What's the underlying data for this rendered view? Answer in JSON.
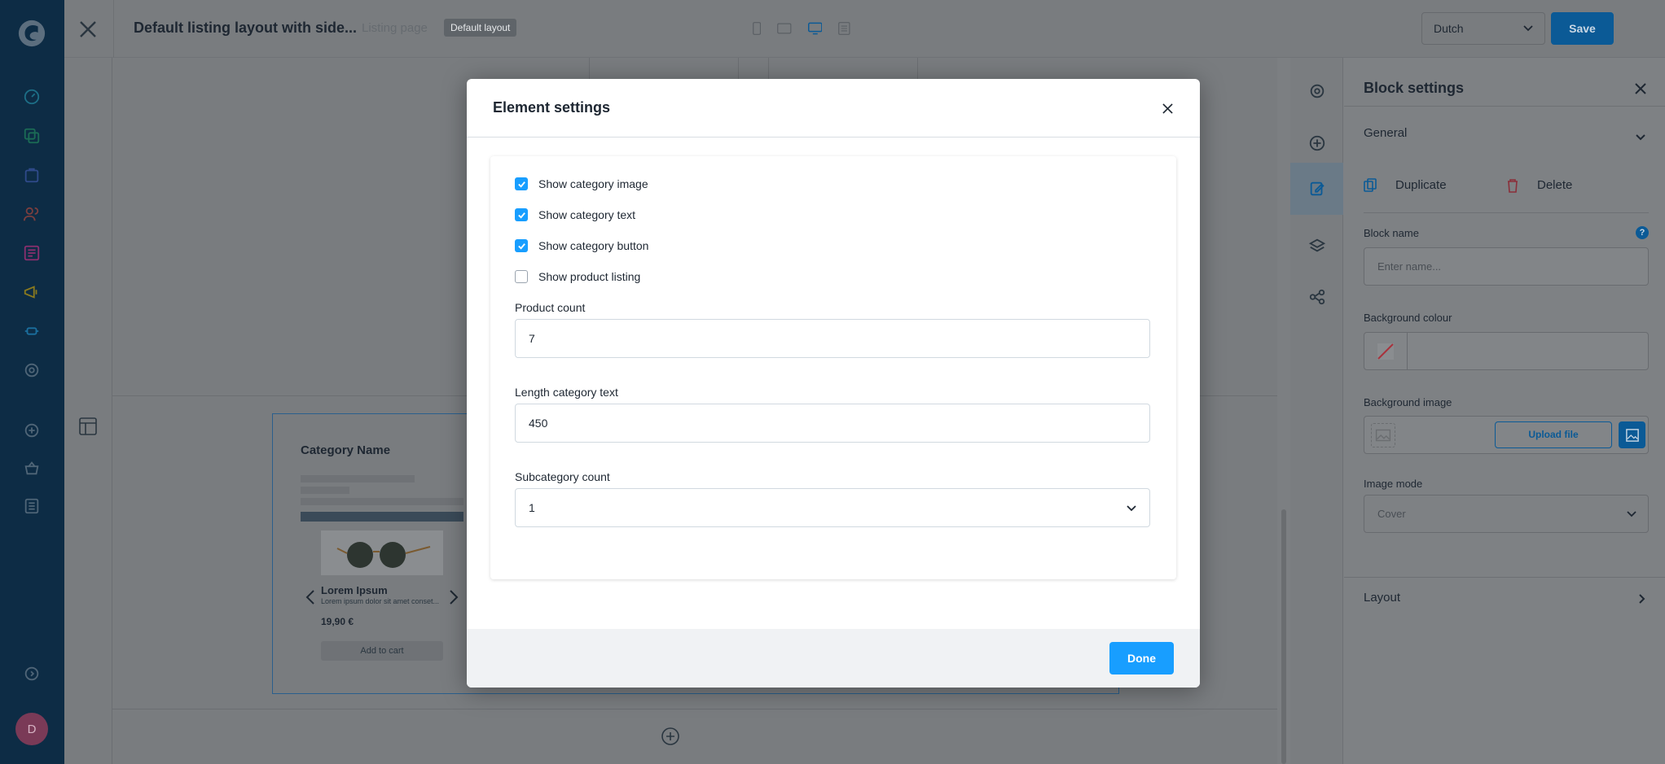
{
  "sidebar": {
    "logo": "shopware-logo",
    "avatar_initial": "D",
    "items": [
      "dashboard",
      "catalogues",
      "orders",
      "customers",
      "content",
      "marketing",
      "extensions",
      "settings"
    ],
    "extra": [
      "add-sales-channel",
      "storefront",
      "headless"
    ]
  },
  "topbar": {
    "title": "Default listing layout with side...",
    "subtitle": "Listing page",
    "badge": "Default layout",
    "language": "Dutch",
    "save_label": "Save"
  },
  "canvas": {
    "category_name": "Category Name",
    "product_name": "Lorem Ipsum",
    "product_desc": "Lorem ipsum dolor sit amet conset...",
    "product_price": "19,90 €",
    "add_to_cart": "Add to cart"
  },
  "right_panel": {
    "title": "Block settings",
    "general": "General",
    "duplicate": "Duplicate",
    "delete": "Delete",
    "block_name_label": "Block name",
    "block_name_placeholder": "Enter name...",
    "bg_colour_label": "Background colour",
    "bg_image_label": "Background image",
    "upload_file": "Upload file",
    "image_mode_label": "Image mode",
    "image_mode_value": "Cover",
    "layout": "Layout"
  },
  "modal": {
    "title": "Element settings",
    "checkboxes": [
      {
        "label": "Show category image",
        "checked": true
      },
      {
        "label": "Show category text",
        "checked": true
      },
      {
        "label": "Show category button",
        "checked": true
      },
      {
        "label": "Show product listing",
        "checked": false
      }
    ],
    "product_count_label": "Product count",
    "product_count_value": "7",
    "length_label": "Length category text",
    "length_value": "450",
    "subcategory_label": "Subcategory count",
    "subcategory_value": "1",
    "done_label": "Done"
  },
  "colors": {
    "accent": "#189eff",
    "sidebar": "#0d2c45"
  }
}
